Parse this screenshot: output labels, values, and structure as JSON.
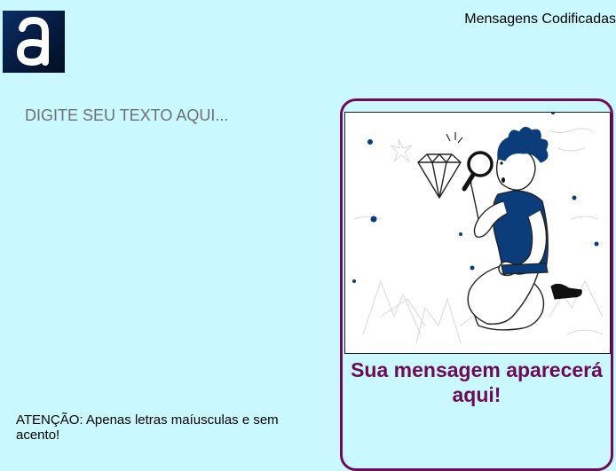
{
  "header": {
    "title": "Mensagens Codificadas",
    "logo_letter": "a",
    "logo_icon": "brand-logo-icon"
  },
  "input": {
    "placeholder": "DIGITE SEU TEXTO AQUI...",
    "value": ""
  },
  "warning": {
    "text": "ATENÇÃO: Apenas letras maíusculas e sem acento!"
  },
  "output": {
    "message": "Sua mensagem aparecerá aqui!",
    "illustration_icon": "person-magnifying-glass-diamond-illustration"
  },
  "colors": {
    "background": "#c9f8fe",
    "accent": "#6e0a5c",
    "illustration_blue": "#0a3d7a",
    "logo_bg": "#061a3d"
  }
}
